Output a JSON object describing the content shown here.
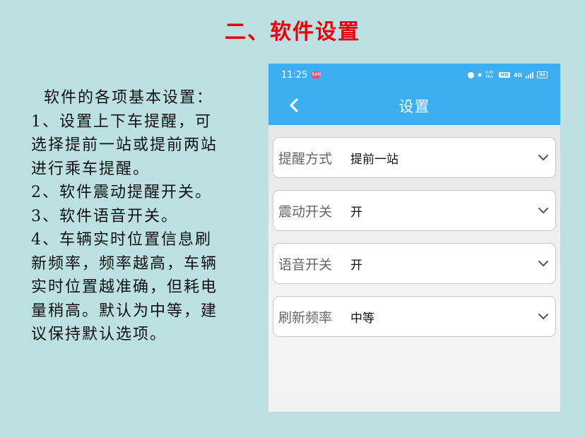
{
  "slide": {
    "title": "二、软件设置",
    "description_lines": [
      "软件的各项基本设置：",
      "1、设置上下车提醒，可",
      "选择提前一站或提前两站",
      "进行乘车提醒。",
      "2、软件震动提醒开关。",
      "3、软件语音开关。",
      "4、车辆实时位置信息刷",
      "新频率，频率越高，车辆",
      "实时位置越准确，但耗电",
      "量稍高。默认为中等，建",
      "议保持默认选项。"
    ]
  },
  "phone": {
    "status_bar": {
      "time": "11:25",
      "app_badge": "SAN",
      "net_speed": "0.00 KB/s",
      "hd": "HD",
      "network": "4G",
      "battery": "88"
    },
    "nav": {
      "title": "设置",
      "back_icon": "chevron-left-icon"
    },
    "settings": [
      {
        "label": "提醒方式",
        "value": "提前一站"
      },
      {
        "label": "震动开关",
        "value": "开"
      },
      {
        "label": "语音开关",
        "value": "开"
      },
      {
        "label": "刷新频率",
        "value": "中等"
      }
    ],
    "colors": {
      "header": "#3daef0",
      "title_red": "#e8000b"
    }
  }
}
